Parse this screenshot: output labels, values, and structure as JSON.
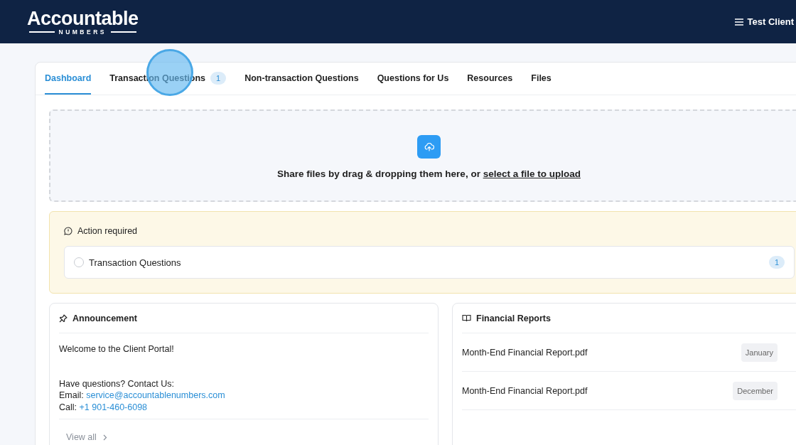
{
  "header": {
    "logo": {
      "word": "Accountable",
      "tagline": "NUMBERS"
    },
    "user": "Test Client"
  },
  "tabs": [
    {
      "label": "Dashboard",
      "selected": true
    },
    {
      "label": "Transaction Questions",
      "selected": false,
      "count": "1"
    },
    {
      "label": "Non-transaction Questions",
      "selected": false
    },
    {
      "label": "Questions for Us",
      "selected": false
    },
    {
      "label": "Resources",
      "selected": false
    },
    {
      "label": "Files",
      "selected": false
    }
  ],
  "upload": {
    "text": "Share files by drag & dropping them here, or",
    "link": "select a file to upload"
  },
  "action_required": {
    "title": "Action required",
    "items": [
      {
        "label": "Transaction Questions",
        "checked": false,
        "count": "1"
      }
    ]
  },
  "announcement": {
    "title": "Announcement",
    "welcome": "Welcome to the Client Portal!",
    "contact_heading": "Have questions? Contact Us:",
    "email_label": "Email:",
    "email": "service@accountablenumbers.com",
    "call_label": "Call:",
    "phone": "+1 901-460-6098",
    "view_all": "View all"
  },
  "financial_reports": {
    "title": "Financial Reports",
    "items": [
      {
        "name": "Month-End Financial Report.pdf",
        "period": "January"
      },
      {
        "name": "Month-End Financial Report.pdf",
        "period": "December"
      }
    ]
  }
}
